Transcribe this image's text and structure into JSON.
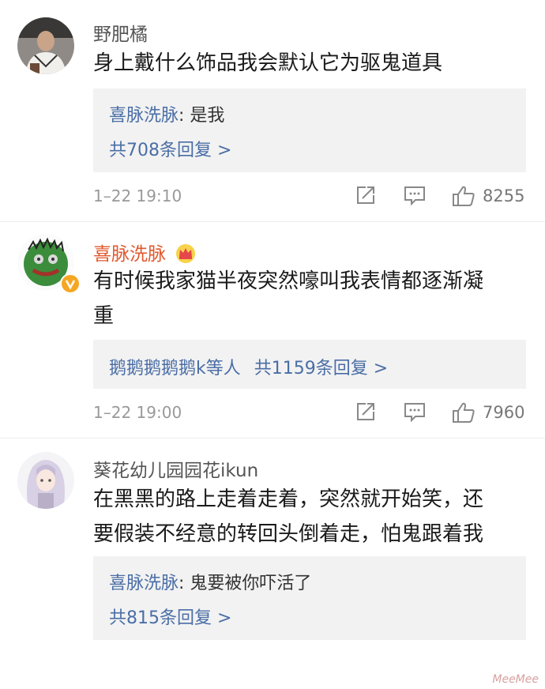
{
  "comments": [
    {
      "username": "野肥橘",
      "content": "身上戴什么饰品我会默认它为驱鬼道具",
      "reply": {
        "author": "喜脉洗脉",
        "text": "是我",
        "count_label": "共708条回复 >"
      },
      "time": "1–22 19:10",
      "likes": "8255"
    },
    {
      "username": "喜脉洗脉",
      "content_line1": "有时候我家猫半夜突然嚎叫我表情都逐渐凝",
      "content_line2": "重",
      "reply": {
        "authors": "鹅鹅鹅鹅鹅k等人",
        "count_label": "共1159条回复 >"
      },
      "time": "1–22 19:00",
      "likes": "7960"
    },
    {
      "username": "葵花幼儿园园花ikun",
      "content_line1": "在黑黑的路上走着走着，突然就开始笑，还",
      "content_line2": "要假装不经意的转回头倒着走，怕鬼跟着我",
      "reply": {
        "author": "喜脉洗脉",
        "text": "鬼要被你吓活了",
        "count_label": "共815条回复 >"
      }
    }
  ],
  "colors": {
    "link": "#4a6ea6",
    "vip_name": "#e2582d",
    "reply_bg": "#f2f2f2",
    "meta": "#999999"
  },
  "icons": [
    "share-icon",
    "comment-icon",
    "like-icon",
    "crown-icon",
    "verified-badge-icon"
  ],
  "watermark": "MeeMee"
}
